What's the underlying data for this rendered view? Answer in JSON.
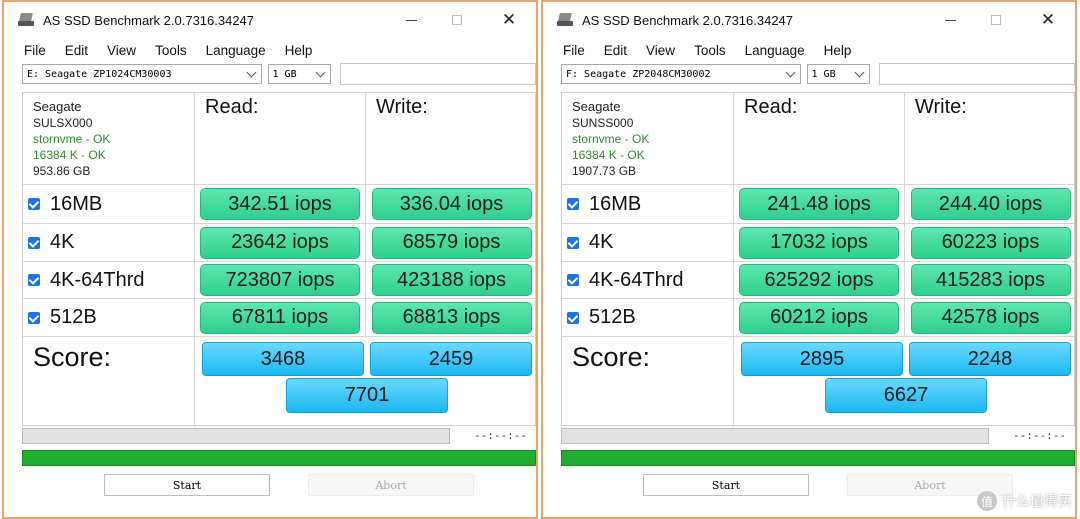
{
  "colors": {
    "read_write_pill": "#2ecf8e",
    "score_pill": "#1bb8f2",
    "progress_done": "#1fae2f",
    "ok_text": "#2d8f2d",
    "window_border": "#e8a56a"
  },
  "windows": [
    {
      "title": "AS SSD Benchmark 2.0.7316.34247",
      "menu": [
        "File",
        "Edit",
        "View",
        "Tools",
        "Language",
        "Help"
      ],
      "drive_select": "E: Seagate ZP1024CM30003",
      "size_select": "1 GB",
      "info": {
        "vendor": "Seagate",
        "firmware": "SULSX000",
        "driver": "stornvme - OK",
        "alignment": "16384 K - OK",
        "capacity": "953.86 GB"
      },
      "headers": {
        "read": "Read:",
        "write": "Write:"
      },
      "rows": [
        {
          "label": "16MB",
          "read": "342.51 iops",
          "write": "336.04 iops"
        },
        {
          "label": "4K",
          "read": "23642 iops",
          "write": "68579 iops"
        },
        {
          "label": "4K-64Thrd",
          "read": "723807 iops",
          "write": "423188 iops"
        },
        {
          "label": "512B",
          "read": "67811 iops",
          "write": "68813 iops"
        }
      ],
      "score": {
        "label": "Score:",
        "read": "3468",
        "write": "2459",
        "total": "7701"
      },
      "timer": "--:--:--",
      "buttons": {
        "start": "Start",
        "abort": "Abort"
      }
    },
    {
      "title": "AS SSD Benchmark 2.0.7316.34247",
      "menu": [
        "File",
        "Edit",
        "View",
        "Tools",
        "Language",
        "Help"
      ],
      "drive_select": "F: Seagate ZP2048CM30002",
      "size_select": "1 GB",
      "info": {
        "vendor": "Seagate",
        "firmware": "SUNSS000",
        "driver": "stornvme - OK",
        "alignment": "16384 K - OK",
        "capacity": "1907.73 GB"
      },
      "headers": {
        "read": "Read:",
        "write": "Write:"
      },
      "rows": [
        {
          "label": "16MB",
          "read": "241.48 iops",
          "write": "244.40 iops"
        },
        {
          "label": "4K",
          "read": "17032 iops",
          "write": "60223 iops"
        },
        {
          "label": "4K-64Thrd",
          "read": "625292 iops",
          "write": "415283 iops"
        },
        {
          "label": "512B",
          "read": "60212 iops",
          "write": "42578 iops"
        }
      ],
      "score": {
        "label": "Score:",
        "read": "2895",
        "write": "2248",
        "total": "6627"
      },
      "timer": "--:--:--",
      "buttons": {
        "start": "Start",
        "abort": "Abort"
      }
    }
  ],
  "watermark": {
    "icon": "值",
    "text": "什么值得买"
  }
}
